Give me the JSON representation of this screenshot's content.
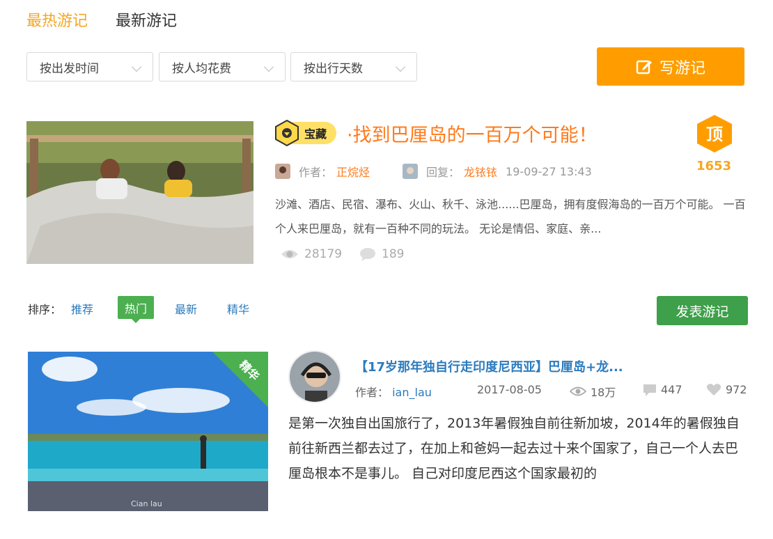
{
  "tabs": {
    "hot": "最热游记",
    "latest": "最新游记"
  },
  "filters": [
    {
      "label": "按出发时间"
    },
    {
      "label": "按人均花费"
    },
    {
      "label": "按出行天数"
    }
  ],
  "write_button": {
    "label": "写游记"
  },
  "article1": {
    "badge": "宝藏",
    "title": "·找到巴厘岛的一百万个可能！",
    "author_label": "作者：",
    "author": "正烷烃",
    "reply_label": "回复：",
    "replier": "龙铱铱",
    "reply_time": "19-09-27 13:43",
    "top_badge": "顶",
    "top_count": "1653",
    "summary": "沙滩、酒店、民宿、瀑布、火山、秋千、泳池......巴厘岛，拥有度假海岛的一百万个可能。 一百个人来巴厘岛，就有一百种不同的玩法。 无论是情侣、家庭、亲...",
    "views": "28179",
    "comments": "189"
  },
  "sort": {
    "label": "排序：",
    "items": [
      "推荐",
      "热门",
      "最新",
      "精华"
    ],
    "active": "热门",
    "publish_button": "发表游记"
  },
  "article2": {
    "corner_badge": "精华",
    "title": "【17岁那年独自行走印度尼西亚】巴厘岛+龙...",
    "author_label": "作者：",
    "author": "ian_lau",
    "date": "2017-08-05",
    "views": "18万",
    "comments": "447",
    "likes": "972",
    "summary": "是第一次独自出国旅行了，2013年暑假独自前往新加坡，2014年的暑假独自前往新西兰都去过了，在加上和爸妈一起去过十来个国家了，自己一个人去巴厘岛根本不是事儿。 自己对印度尼西这个国家最初的",
    "photo_watermark": "Cian lau"
  },
  "colors": {
    "accent": "#f5a623",
    "orange_btn": "#ff9d00",
    "green": "#3ea04a",
    "link": "#2b7bbd"
  }
}
